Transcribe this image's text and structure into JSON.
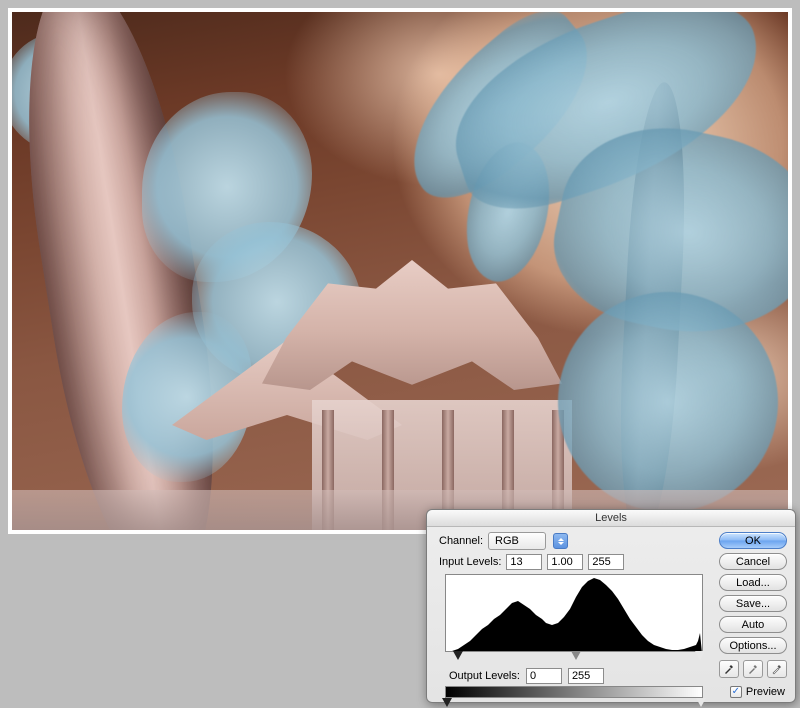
{
  "dialog": {
    "title": "Levels",
    "channel_label": "Channel:",
    "channel_value": "RGB",
    "input_label": "Input Levels:",
    "input_black": "13",
    "input_gamma": "1.00",
    "input_white": "255",
    "output_label": "Output Levels:",
    "output_black": "0",
    "output_white": "255",
    "buttons": {
      "ok": "OK",
      "cancel": "Cancel",
      "load": "Load...",
      "save": "Save...",
      "auto": "Auto",
      "options": "Options..."
    },
    "preview_label": "Preview",
    "preview_checked": true
  }
}
